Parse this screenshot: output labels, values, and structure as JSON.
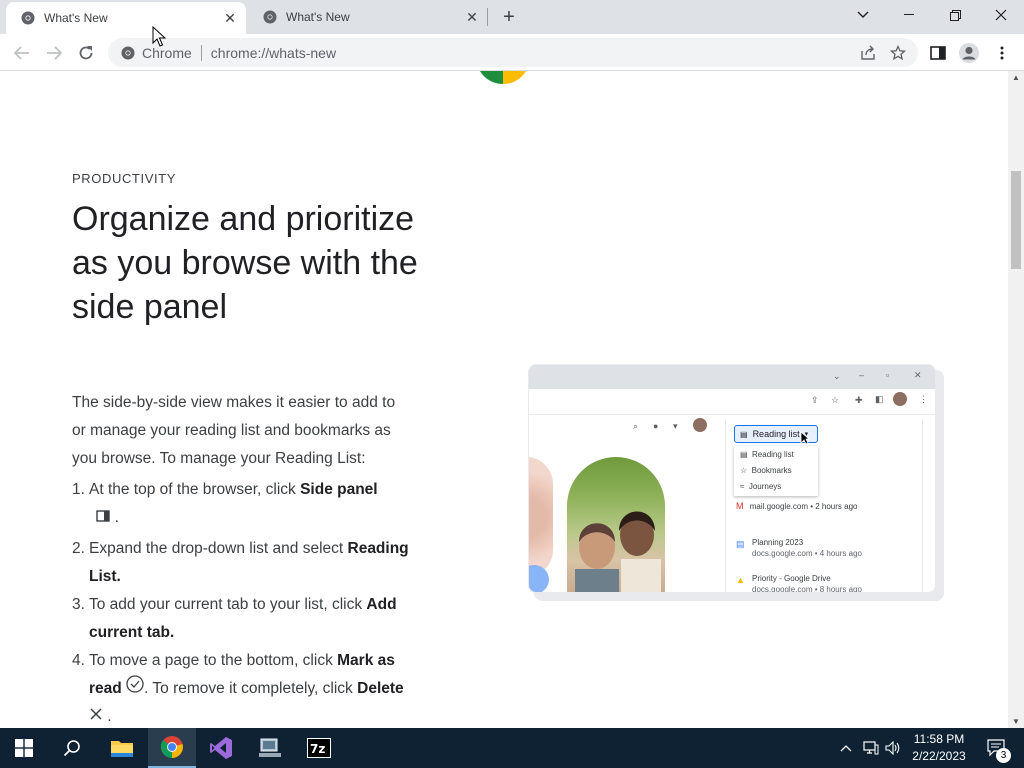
{
  "browser": {
    "tabs": [
      {
        "title": "What's New",
        "active": true
      },
      {
        "title": "What's New",
        "active": false
      }
    ],
    "omnibox": {
      "chip": "Chrome",
      "url": "chrome://whats-new"
    }
  },
  "page": {
    "eyebrow": "PRODUCTIVITY",
    "headline": "Organize and prioritize as you browse with the side panel",
    "intro": "The side-by-side view makes it easier to add to or manage your reading list and bookmarks as you browse. To manage your Reading List:",
    "steps": [
      {
        "num": "1.",
        "pre": "At the top of the browser, click ",
        "bold": "Side panel",
        "post": " ."
      },
      {
        "num": "2.",
        "pre": "Expand the drop-down list and select ",
        "bold": "Reading List.",
        "post": ""
      },
      {
        "num": "3.",
        "pre": "To add your current tab to your list, click ",
        "bold": "Add current tab.",
        "post": ""
      },
      {
        "num": "4.",
        "pre": "To move a page to the bottom, click ",
        "bold": "Mark as read",
        "post": ". To remove it completely, click ",
        "bold2": "Delete",
        "post2": " ."
      }
    ]
  },
  "illustration": {
    "dropdown_label": "Reading list",
    "menu": [
      "Reading list",
      "Bookmarks",
      "Journeys"
    ],
    "items": [
      {
        "title": "mail.google.com • 2 hours ago",
        "sub": ""
      },
      {
        "title": "Planning 2023",
        "sub": "docs.google.com • 4 hours ago"
      },
      {
        "title": "Priority - Google Drive",
        "sub": "docs.google.com • 8 hours ago"
      }
    ]
  },
  "taskbar": {
    "clock_time": "11:58 PM",
    "clock_date": "2/22/2023",
    "notifications": "3"
  },
  "colors": {
    "tabstrip": "#dee1e6",
    "taskbar": "#0f2233",
    "accent": "#1a73e8"
  }
}
